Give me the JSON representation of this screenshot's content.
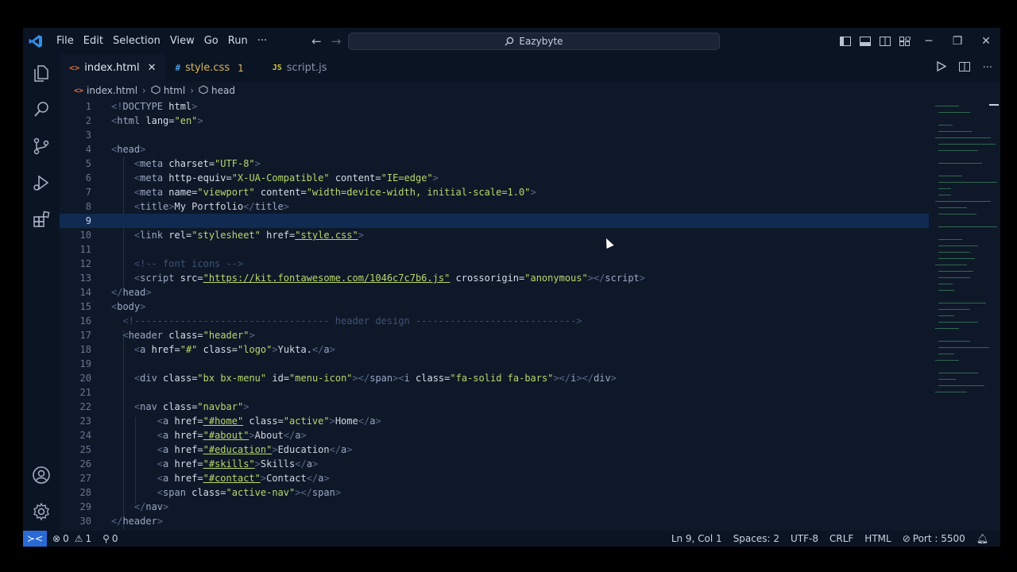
{
  "titlebar": {
    "menu": [
      "File",
      "Edit",
      "Selection",
      "View",
      "Go",
      "Run",
      "···"
    ],
    "search_label": "Eazybyte",
    "accent": "#2a6ad6"
  },
  "tabs": [
    {
      "label": "index.html",
      "icon": "html-icon",
      "icon_glyph": "<>",
      "active": true
    },
    {
      "label": "style.css",
      "icon": "css-icon",
      "icon_glyph": "#",
      "badge": "1"
    },
    {
      "label": "script.js",
      "icon": "js-icon",
      "icon_glyph": "JS"
    }
  ],
  "breadcrumbs": {
    "file": "index.html",
    "items": [
      "html",
      "head"
    ]
  },
  "editor": {
    "current_line": 9,
    "lines": [
      {
        "n": "1"
      },
      {
        "n": "2"
      },
      {
        "n": "3"
      },
      {
        "n": "4"
      },
      {
        "n": "5"
      },
      {
        "n": "6"
      },
      {
        "n": "7"
      },
      {
        "n": "8"
      },
      {
        "n": "9"
      },
      {
        "n": "10"
      },
      {
        "n": "11"
      },
      {
        "n": "12"
      },
      {
        "n": "13"
      },
      {
        "n": "14"
      },
      {
        "n": "15"
      },
      {
        "n": "16"
      },
      {
        "n": "17"
      },
      {
        "n": "18"
      },
      {
        "n": "19"
      },
      {
        "n": "20"
      },
      {
        "n": "21"
      },
      {
        "n": "22"
      },
      {
        "n": "23"
      },
      {
        "n": "24"
      },
      {
        "n": "25"
      },
      {
        "n": "26"
      },
      {
        "n": "27"
      },
      {
        "n": "28"
      },
      {
        "n": "29"
      },
      {
        "n": "30"
      }
    ],
    "code": {
      "l1": {
        "open": "<!",
        "name": "DOCTYPE",
        "attr": " html",
        "close": ">"
      },
      "l2": {
        "open": "<",
        "name": "html",
        "attr": " lang",
        "eq": "=",
        "val": "\"en\"",
        "close": ">"
      },
      "l4": {
        "open": "<",
        "name": "head",
        "close": ">"
      },
      "l5": {
        "open": "<",
        "name": "meta",
        "attr": " charset",
        "eq": "=",
        "val": "\"UTF-8\"",
        "close": ">"
      },
      "l6": {
        "open": "<",
        "name": "meta",
        "attr1": " http-equiv",
        "eq1": "=",
        "val1": "\"X-UA-Compatible\"",
        "attr2": " content",
        "eq2": "=",
        "val2": "\"IE=edge\"",
        "close": ">"
      },
      "l7": {
        "open": "<",
        "name": "meta",
        "attr1": " name",
        "eq1": "=",
        "val1": "\"viewport\"",
        "attr2": " content",
        "eq2": "=",
        "val2": "\"width=device-width, initial-scale=1.0\"",
        "close": ">"
      },
      "l8": {
        "open": "<",
        "name": "title",
        "close": ">",
        "text": "My Portfolio",
        "end_open": "</",
        "end_name": "title",
        "end_close": ">"
      },
      "l10": {
        "open": "<",
        "name": "link",
        "attr1": " rel",
        "eq1": "=",
        "val1": "\"stylesheet\"",
        "attr2": " href",
        "eq2": "=",
        "val2": "\"style.css\"",
        "close": ">"
      },
      "l12": {
        "comment": "<!-- font icons -->"
      },
      "l13": {
        "open": "<",
        "name": "script",
        "attr1": " src",
        "eq1": "=",
        "val1": "\"https://kit.fontawesome.com/1046c7c7b6.js\"",
        "attr2": " crossorigin",
        "eq2": "=",
        "val2": "\"anonymous\"",
        "close": "></",
        "end_name": "script",
        "end_close": ">"
      },
      "l14": {
        "open": "</",
        "name": "head",
        "close": ">"
      },
      "l15": {
        "open": "<",
        "name": "body",
        "close": ">"
      },
      "l16": {
        "comment": "<!---------------------------------- header design ---------------------------->"
      },
      "l17": {
        "open": "<",
        "name": "header",
        "attr": " class",
        "eq": "=",
        "val": "\"header\"",
        "close": ">"
      },
      "l18": {
        "open": "<",
        "name": "a",
        "attr1": " href",
        "eq1": "=",
        "val1": "\"#\"",
        "attr2": " class",
        "eq2": "=",
        "val2": "\"logo\"",
        "close": ">",
        "text": "Yukta.",
        "end_open": "</",
        "end_name": "a",
        "end_close": ">"
      },
      "l20": {
        "open": "<",
        "name": "div",
        "attr1": " class",
        "eq1": "=",
        "val1": "\"bx bx-menu\"",
        "attr2": " id",
        "eq2": "=",
        "val2": "\"menu-icon\"",
        "mid": "></",
        "mid_name": "span",
        "mid2": "><",
        "i_name": "i",
        "attr3": " class",
        "eq3": "=",
        "val3": "\"fa-solid fa-bars\"",
        "close": "></",
        "end_name": "i",
        "close2": "></",
        "end_name2": "div",
        "end_close": ">"
      },
      "l22": {
        "open": "<",
        "name": "nav",
        "attr": " class",
        "eq": "=",
        "val": "\"navbar\"",
        "close": ">"
      },
      "l23": {
        "open": "<",
        "name": "a",
        "attr1": " href",
        "eq1": "=",
        "val1": "\"#home\"",
        "attr2": " class",
        "eq2": "=",
        "val2": "\"active\"",
        "close": ">",
        "text": "Home",
        "end_open": "</",
        "end_name": "a",
        "end_close": ">"
      },
      "l24": {
        "open": "<",
        "name": "a",
        "attr": " href",
        "eq": "=",
        "val": "\"#about\"",
        "close": ">",
        "text": "About",
        "end_open": "</",
        "end_name": "a",
        "end_close": ">"
      },
      "l25": {
        "open": "<",
        "name": "a",
        "attr": " href",
        "eq": "=",
        "val": "\"#education\"",
        "close": ">",
        "text": "Education",
        "end_open": "</",
        "end_name": "a",
        "end_close": ">"
      },
      "l26": {
        "open": "<",
        "name": "a",
        "attr": " href",
        "eq": "=",
        "val": "\"#skills\"",
        "close": ">",
        "text": "Skills",
        "end_open": "</",
        "end_name": "a",
        "end_close": ">"
      },
      "l27": {
        "open": "<",
        "name": "a",
        "attr": " href",
        "eq": "=",
        "val": "\"#contact\"",
        "close": ">",
        "text": "Contact",
        "end_open": "</",
        "end_name": "a",
        "end_close": ">"
      },
      "l28": {
        "open": "<",
        "name": "span",
        "attr": " class",
        "eq": "=",
        "val": "\"active-nav\"",
        "close": "></",
        "end_name": "span",
        "end_close": ">"
      },
      "l29": {
        "open": "</",
        "name": "nav",
        "close": ">"
      },
      "l30": {
        "open": "</",
        "name": "header",
        "close": ">"
      }
    }
  },
  "statusbar": {
    "errors": "0",
    "warnings": "1",
    "ports": "0",
    "position": "Ln 9, Col 1",
    "spaces": "Spaces: 2",
    "encoding": "UTF-8",
    "eol": "CRLF",
    "language": "HTML",
    "port": "Port : 5500"
  }
}
